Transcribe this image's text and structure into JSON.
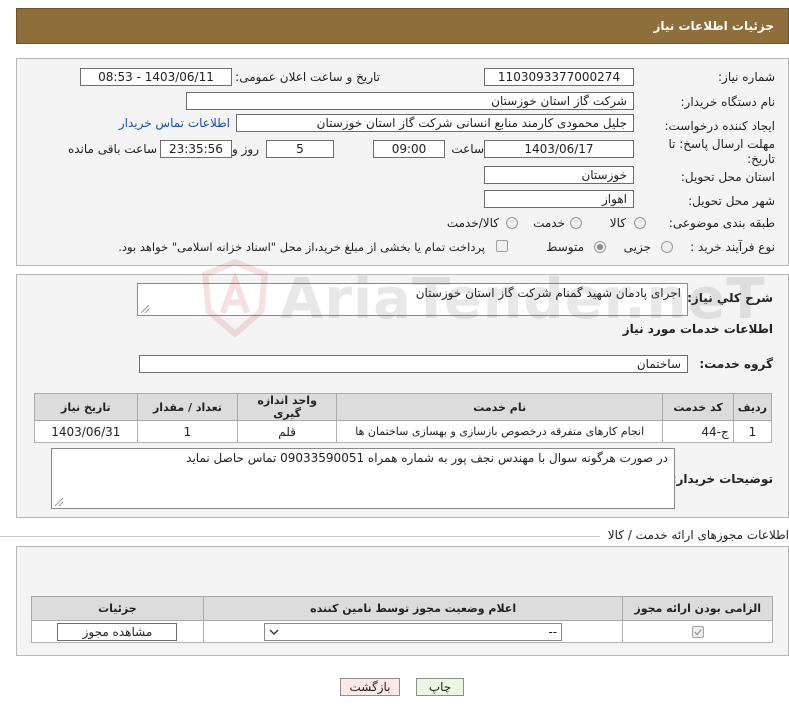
{
  "header": {
    "title": "جزئیات اطلاعات نیاز"
  },
  "fields": {
    "need_number_label": "شماره نیاز:",
    "need_number": "1103093377000274",
    "announce_label": "تاریخ و ساعت اعلان عمومی:",
    "announce_value": "1403/06/11 - 08:53",
    "buyer_org_label": "نام دستگاه خریدار:",
    "buyer_org": "شرکت گاز استان خوزستان",
    "creator_label": "ایجاد کننده درخواست:",
    "creator": "جلیل محمودی کارمند منابع انسانی شرکت گاز استان خوزستان",
    "buyer_contact_link": "اطلاعات تماس خریدار",
    "deadline_label_1": "مهلت ارسال پاسخ: تا",
    "deadline_label_2": "تاریخ:",
    "deadline_date": "1403/06/17",
    "time_label": "ساعت",
    "deadline_time": "09:00",
    "days_value": "5",
    "days_label": "روز و",
    "remaining_time": "23:35:56",
    "remaining_label": "ساعت باقی مانده",
    "province_label": "استان محل تحویل:",
    "province": "خوزستان",
    "city_label": "شهر محل تحویل:",
    "city": "اهواز",
    "category_label": "طبقه بندی موضوعی:",
    "category_options": [
      "کالا",
      "خدمت",
      "کالا/خدمت"
    ],
    "process_label": "نوع فرآیند خرید :",
    "process_options": [
      "جزیی",
      "متوسط"
    ],
    "payment_text": "پرداخت تمام یا بخشی از مبلغ خرید،از محل \"اسناد خزانه اسلامی\" خواهد بود."
  },
  "summary": {
    "label": "شرح کلي نياز:",
    "text": "اجرای پادمان شهید گمنام شرکت گاز استان خوزستان",
    "services_title": "اطلاعات خدمات مورد نیاز",
    "group_label": "گروه خدمت:",
    "group_value": "ساختمان"
  },
  "services_table": {
    "headers": [
      "ردیف",
      "کد خدمت",
      "نام خدمت",
      "واحد اندازه گیری",
      "تعداد / مقدار",
      "تاریخ نیاز"
    ],
    "rows": [
      [
        "1",
        "ج-44",
        "انجام کارهای متفرقه درخصوص بازسازی و بهسازی ساختمان ها",
        "قلم",
        "1",
        "1403/06/31"
      ]
    ]
  },
  "buyer_notes": {
    "label": "توضیحات خریدار:",
    "text": "در صورت هرگونه سوال با مهندس نجف پور به شماره همراه 09033590051 تماس حاصل نماید"
  },
  "permits": {
    "section_title": "اطلاعات مجوزهای ارائه خدمت / کالا",
    "headers": [
      "الزامی بودن ارائه مجوز",
      "اعلام وضعیت مجوز توسط نامین کننده",
      "جزئیات"
    ],
    "select_value": "--",
    "view_button": "مشاهده مجوز"
  },
  "buttons": {
    "print": "چاپ",
    "back": "بازگشت"
  },
  "watermark": {
    "text": "AriaTender.neT"
  },
  "colors": {
    "header_bg": "#8e6e3a",
    "link": "#1a4fb5",
    "back_button": "#fde8e8",
    "print_button": "#eaf7e4"
  }
}
